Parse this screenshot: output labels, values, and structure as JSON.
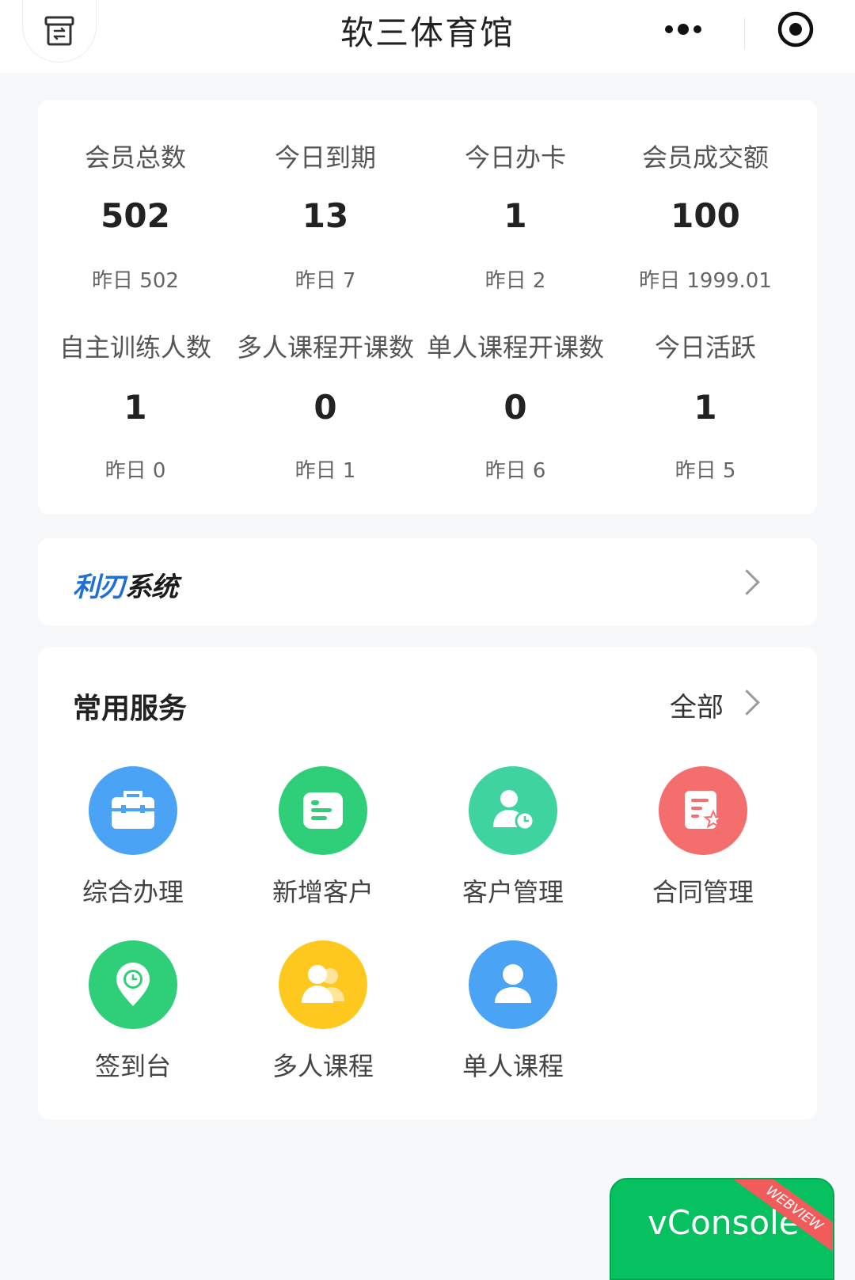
{
  "header": {
    "title": "软三体育馆",
    "home_icon": "archive-box-icon",
    "more_icon": "more-dots-icon",
    "close_icon": "target-circle-icon"
  },
  "stats": [
    {
      "label": "会员总数",
      "value": "502",
      "prev": "昨日 502"
    },
    {
      "label": "今日到期",
      "value": "13",
      "prev": "昨日 7"
    },
    {
      "label": "今日办卡",
      "value": "1",
      "prev": "昨日 2"
    },
    {
      "label": "会员成交额",
      "value": "100",
      "prev": "昨日 1999.01"
    },
    {
      "label": "自主训练人数",
      "value": "1",
      "prev": "昨日 0"
    },
    {
      "label": "多人课程开课数",
      "value": "0",
      "prev": "昨日 1"
    },
    {
      "label": "单人课程开课数",
      "value": "0",
      "prev": "昨日 6"
    },
    {
      "label": "今日活跃",
      "value": "1",
      "prev": "昨日 5"
    }
  ],
  "brand": {
    "part1": "利刃",
    "part2": "系统",
    "color_primary": "#1f6fd6"
  },
  "services": {
    "title": "常用服务",
    "all_label": "全部",
    "items": [
      {
        "label": "综合办理",
        "icon": "briefcase-icon",
        "color": "#4aa3f5"
      },
      {
        "label": "新增客户",
        "icon": "card-list-icon",
        "color": "#2fcf7a"
      },
      {
        "label": "客户管理",
        "icon": "user-clock-icon",
        "color": "#3fd3a0"
      },
      {
        "label": "合同管理",
        "icon": "document-star-icon",
        "color": "#f56e6e"
      },
      {
        "label": "签到台",
        "icon": "location-clock-icon",
        "color": "#2fcf7a"
      },
      {
        "label": "多人课程",
        "icon": "users-icon",
        "color": "#ffc81f"
      },
      {
        "label": "单人课程",
        "icon": "user-icon",
        "color": "#4aa3f5"
      }
    ]
  },
  "vconsole": {
    "label": "vConsole",
    "ribbon": "WEBVIEW",
    "color": "#07c160"
  }
}
